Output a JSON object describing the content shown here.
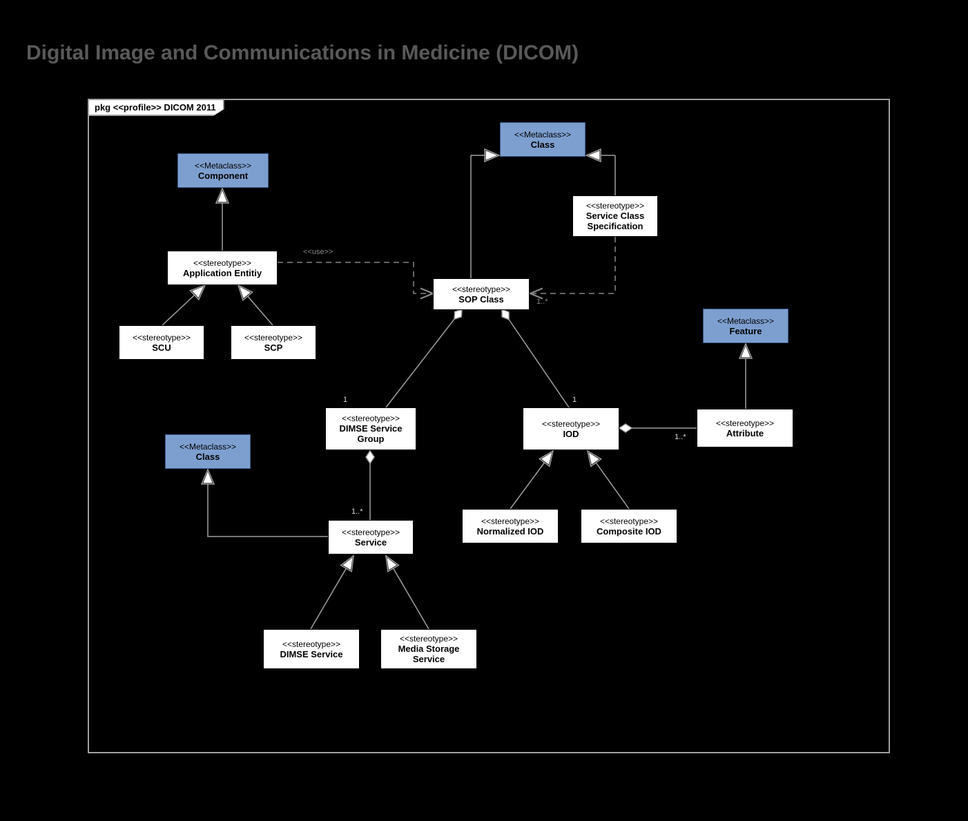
{
  "title": "Digital Image and Communications in Medicine (DICOM)",
  "frame_label": "pkg <<profile>> DICOM 2011",
  "nodes": {
    "component": {
      "stereo": "<<Metaclass>>",
      "name": "Component"
    },
    "class_top": {
      "stereo": "<<Metaclass>>",
      "name": "Class"
    },
    "feature": {
      "stereo": "<<Metaclass>>",
      "name": "Feature"
    },
    "class_mid": {
      "stereo": "<<Metaclass>>",
      "name": "Class"
    },
    "app_entity": {
      "stereo": "<<stereotype>>",
      "name": "Application Entitiy"
    },
    "scu": {
      "stereo": "<<stereotype>>",
      "name": "SCU"
    },
    "scp": {
      "stereo": "<<stereotype>>",
      "name": "SCP"
    },
    "scs": {
      "stereo": "<<stereotype>>",
      "name": "Service Class Specification"
    },
    "sop": {
      "stereo": "<<stereotype>>",
      "name": "SOP Class"
    },
    "dsg": {
      "stereo": "<<stereotype>>",
      "name": "DIMSE Service Group"
    },
    "iod": {
      "stereo": "<<stereotype>>",
      "name": "IOD"
    },
    "attribute": {
      "stereo": "<<stereotype>>",
      "name": "Attribute"
    },
    "service": {
      "stereo": "<<stereotype>>",
      "name": "Service"
    },
    "norm_iod": {
      "stereo": "<<stereotype>>",
      "name": "Normalized IOD"
    },
    "comp_iod": {
      "stereo": "<<stereotype>>",
      "name": "Composite IOD"
    },
    "dimse_svc": {
      "stereo": "<<stereotype>>",
      "name": "DIMSE Service"
    },
    "media_svc": {
      "stereo": "<<stereotype>>",
      "name": "Media Storage Service"
    }
  },
  "labels": {
    "use": "<<use>>",
    "one_a": "1",
    "one_b": "1",
    "one_star_a": "1..*",
    "one_star_b": "1..*",
    "one_star_c": "1..*"
  }
}
